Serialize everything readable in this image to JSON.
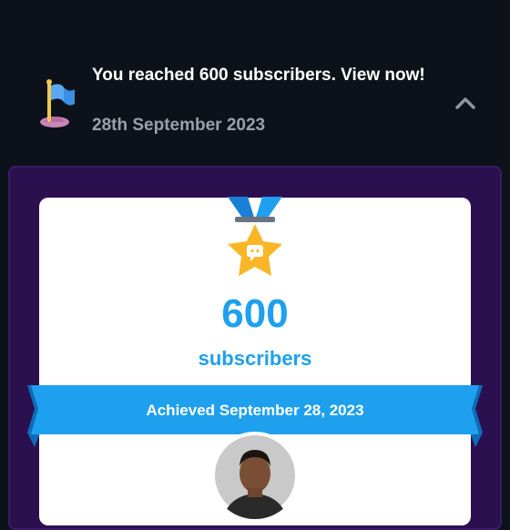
{
  "notification": {
    "title": "You reached 600 subscribers. View now!",
    "date": "28th September 2023",
    "icon": "flag-icon",
    "toggle_icon": "chevron-up-icon"
  },
  "milestone": {
    "count": "600",
    "unit": "subscribers",
    "achieved": "Achieved September 28, 2023",
    "medal_icon": "star-medal-icon",
    "colors": {
      "accent": "#1ea0ee",
      "star": "#fbb627",
      "panel": "#2b1050",
      "background": "#0d1119"
    }
  }
}
